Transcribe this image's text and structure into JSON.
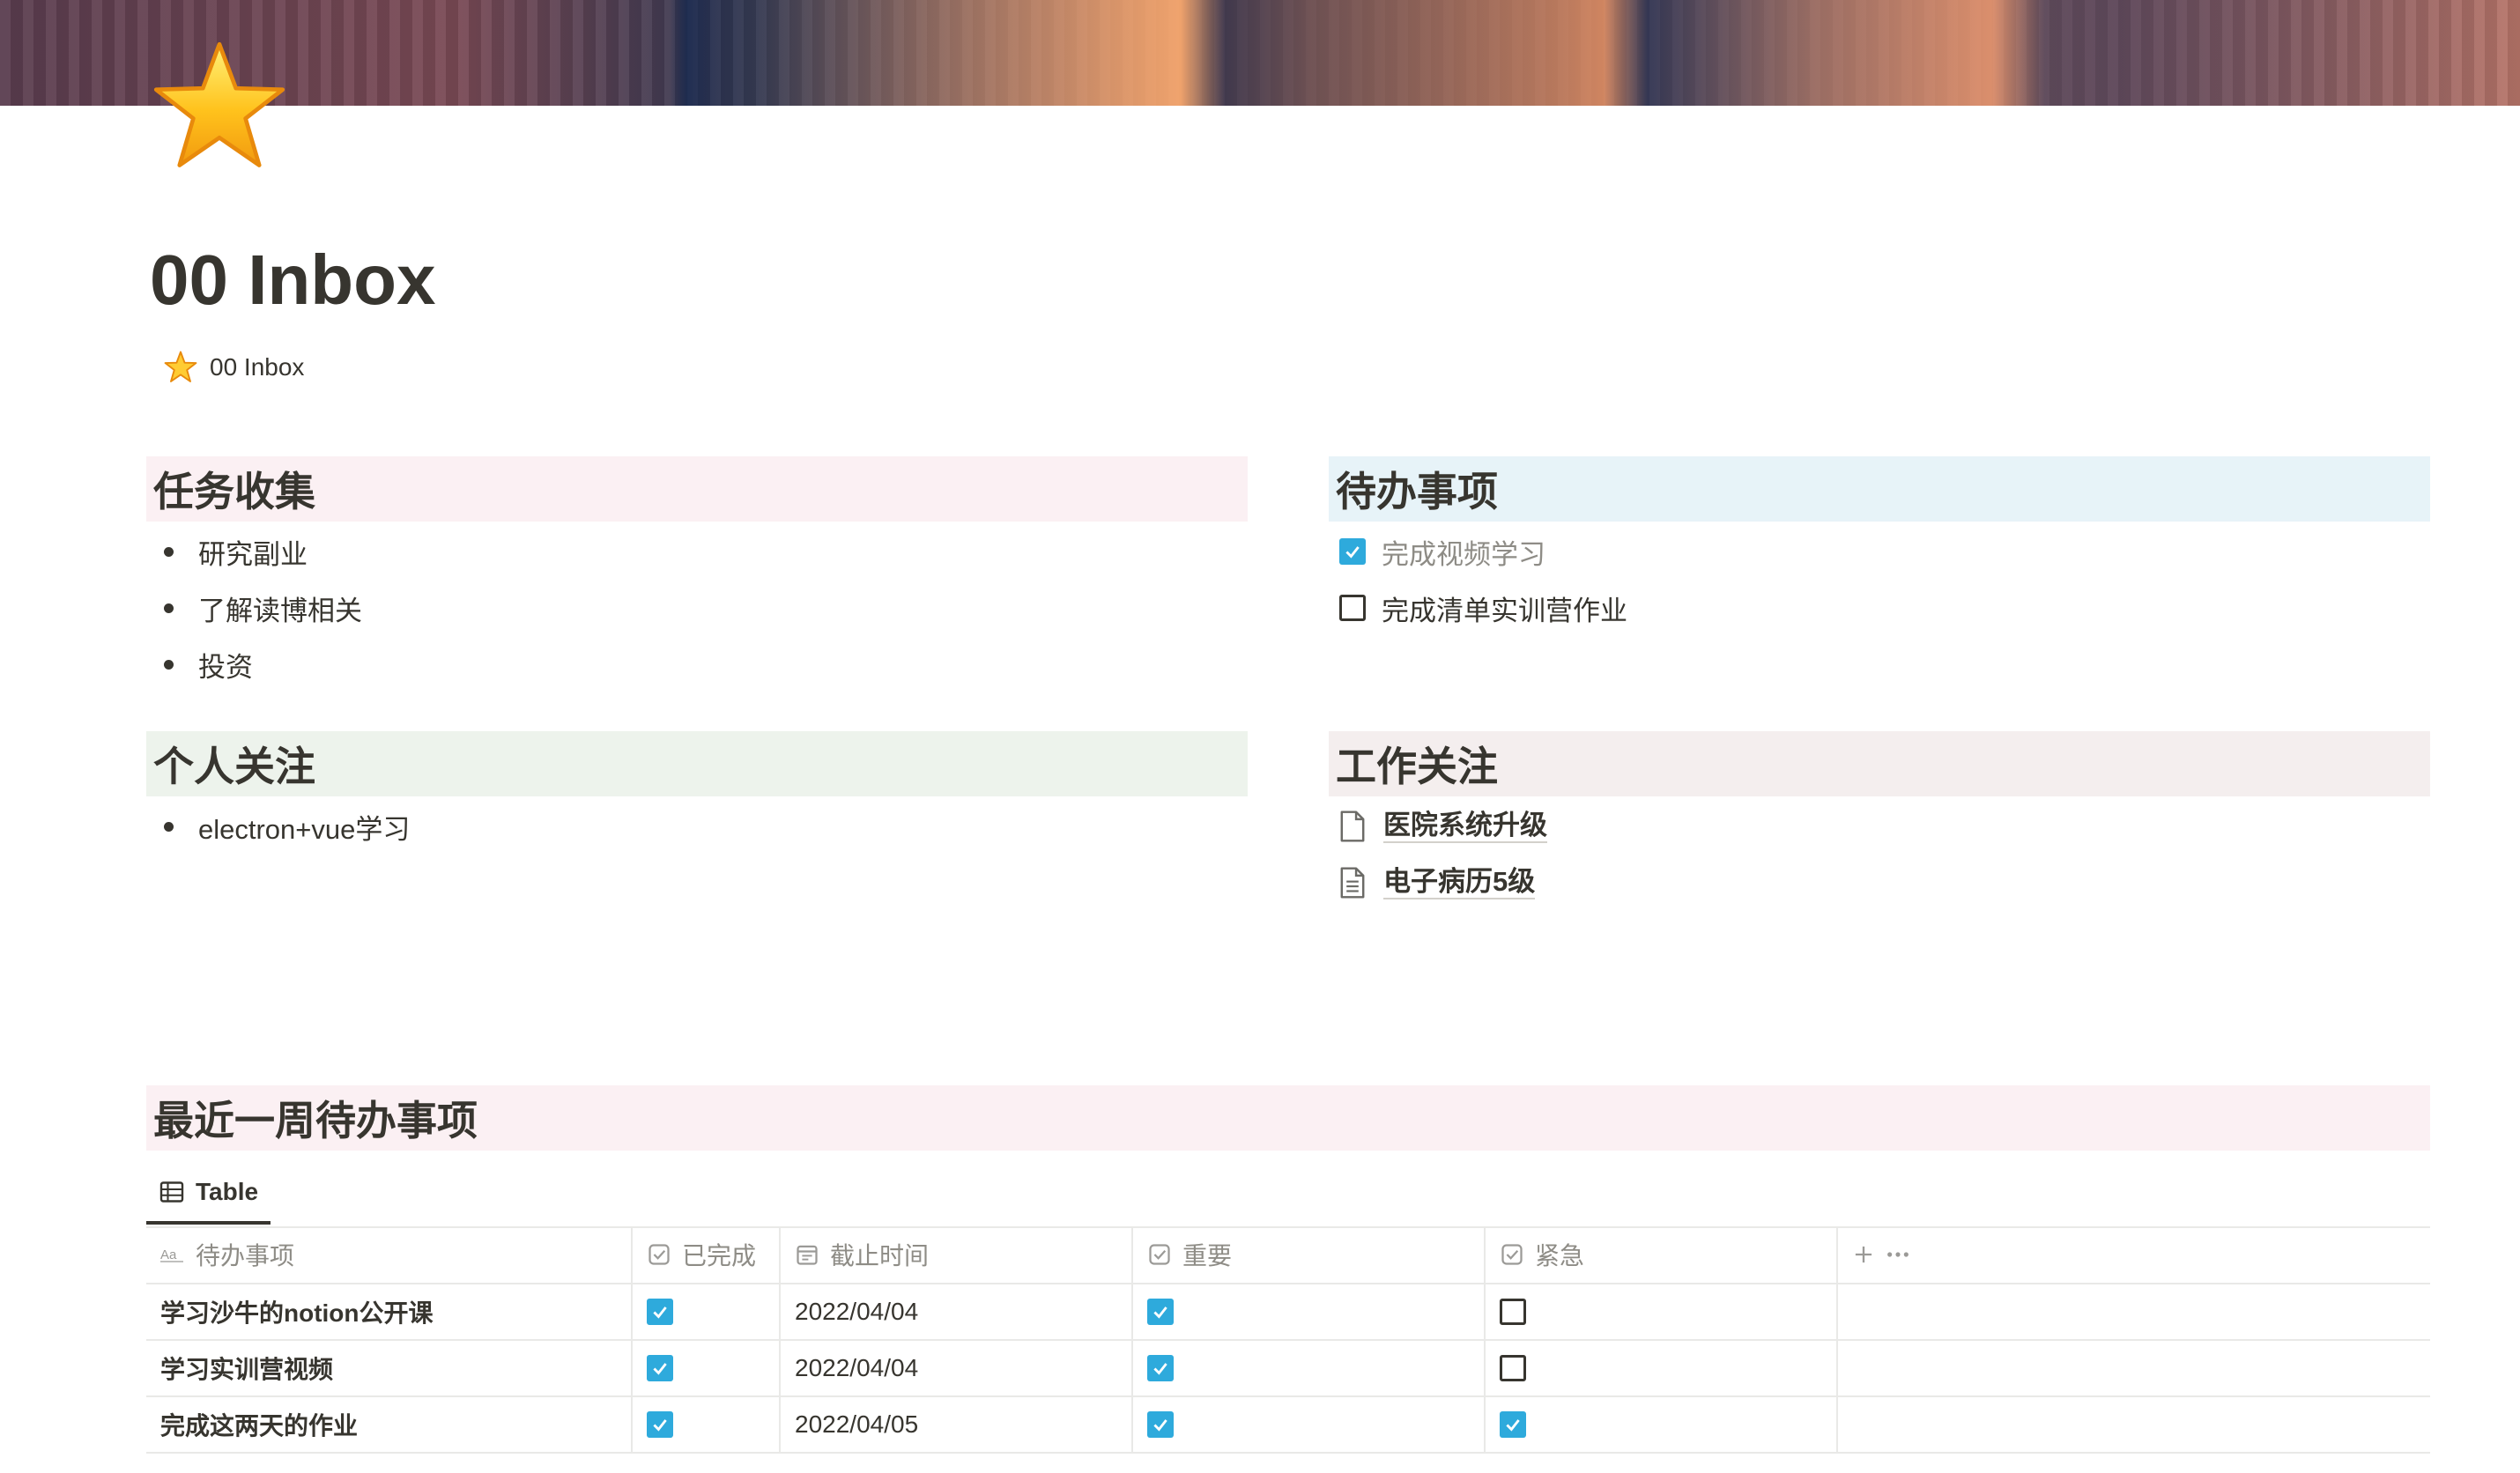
{
  "page": {
    "title": "00 Inbox",
    "breadcrumb": "00 Inbox",
    "icon": "star-icon"
  },
  "sections": {
    "task_collection": {
      "heading": "任务收集",
      "items": [
        "研究副业",
        "了解读博相关",
        "投资"
      ]
    },
    "todos": {
      "heading": "待办事项",
      "items": [
        {
          "label": "完成视频学习",
          "checked": true
        },
        {
          "label": "完成清单实训营作业",
          "checked": false
        }
      ]
    },
    "personal": {
      "heading": "个人关注",
      "items": [
        "electron+vue学习"
      ]
    },
    "work": {
      "heading": "工作关注",
      "links": [
        {
          "label": "医院系统升级",
          "icon": "blank-page-icon"
        },
        {
          "label": "电子病历5级",
          "icon": "text-page-icon"
        }
      ]
    },
    "weekly": {
      "heading": "最近一周待办事项"
    }
  },
  "database": {
    "view_tab": "Table",
    "columns": [
      "待办事项",
      "已完成",
      "截止时间",
      "重要",
      "紧急"
    ],
    "rows": [
      {
        "name": "学习沙牛的notion公开课",
        "done": true,
        "due": "2022/04/04",
        "important": true,
        "urgent": false
      },
      {
        "name": "学习实训营视频",
        "done": true,
        "due": "2022/04/04",
        "important": true,
        "urgent": false
      },
      {
        "name": "完成这两天的作业",
        "done": true,
        "due": "2022/04/05",
        "important": true,
        "urgent": true
      }
    ]
  },
  "colors": {
    "checkbox_checked": "#2eaadc",
    "pink_bg": "#fbf0f3",
    "blue_bg": "#e7f3f8",
    "green_bg": "#edf3ec",
    "brown_bg": "#f4eeee"
  }
}
